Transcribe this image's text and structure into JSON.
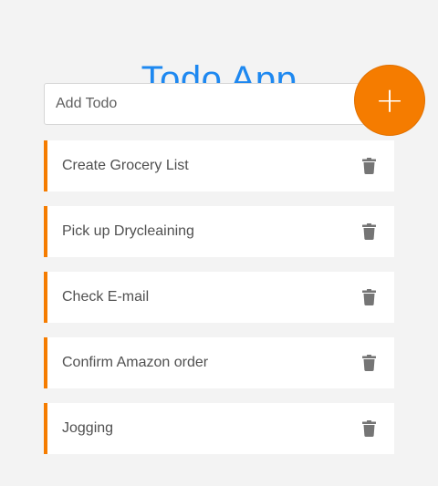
{
  "app": {
    "title": "Todo App"
  },
  "add_todo": {
    "placeholder": "Add Todo",
    "value": "",
    "button_label": "+"
  },
  "todos": [
    {
      "text": "Create Grocery List",
      "delete_icon": "trash-icon"
    },
    {
      "text": "Pick up Drycleaining",
      "delete_icon": "trash-icon"
    },
    {
      "text": "Check E-mail",
      "delete_icon": "trash-icon"
    },
    {
      "text": "Confirm Amazon order",
      "delete_icon": "trash-icon"
    },
    {
      "text": "Jogging",
      "delete_icon": "trash-icon"
    }
  ],
  "colors": {
    "title": "#1e88f0",
    "accent": "#f57c00",
    "background": "#f3f3f3",
    "item_background": "#ffffff",
    "icon": "#757575"
  }
}
